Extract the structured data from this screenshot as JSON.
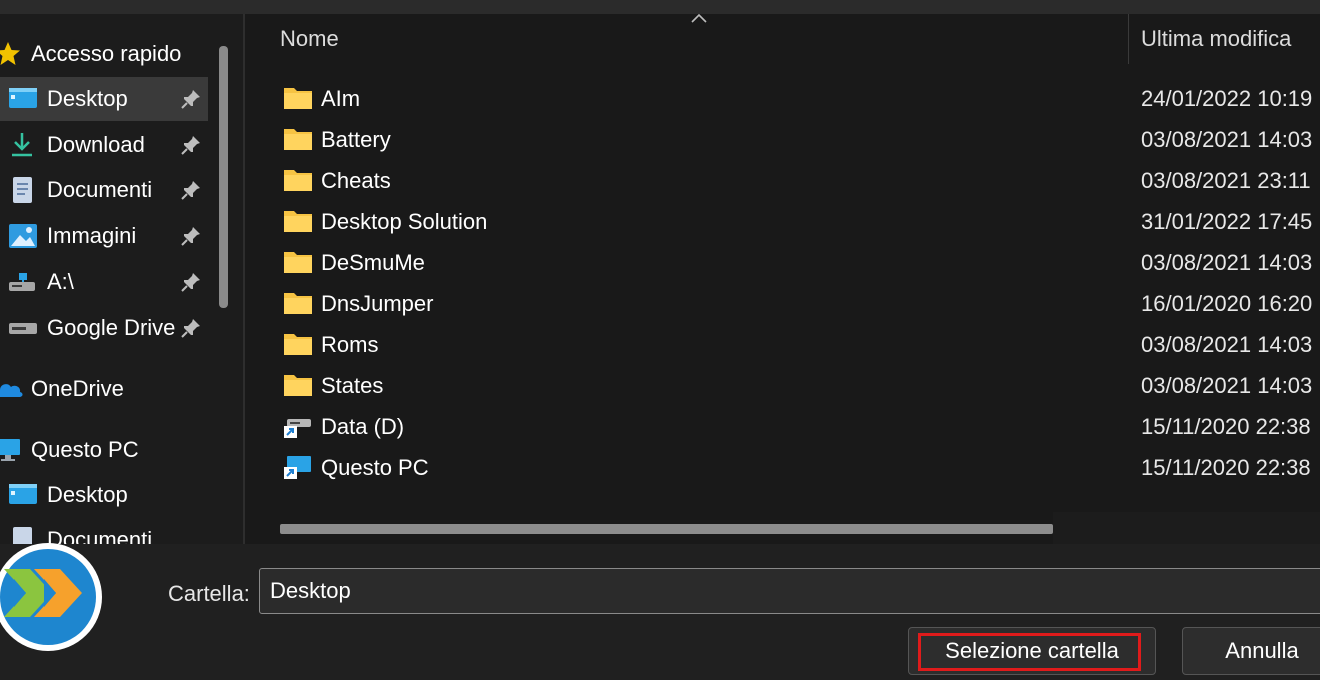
{
  "sidebar": {
    "items": [
      {
        "label": "Accesso rapido",
        "icon": "star-icon",
        "pinned": false,
        "selected": false
      },
      {
        "label": "Desktop",
        "icon": "desktop-icon",
        "pinned": true,
        "selected": true
      },
      {
        "label": "Download",
        "icon": "download-icon",
        "pinned": true,
        "selected": false
      },
      {
        "label": "Documenti",
        "icon": "document-icon",
        "pinned": true,
        "selected": false
      },
      {
        "label": "Immagini",
        "icon": "pictures-icon",
        "pinned": true,
        "selected": false
      },
      {
        "label": "A:\\",
        "icon": "network-drive-icon",
        "pinned": true,
        "selected": false
      },
      {
        "label": "Google Drive",
        "icon": "drive-icon",
        "pinned": true,
        "selected": false
      },
      {
        "label": "OneDrive",
        "icon": "cloud-icon",
        "pinned": false,
        "selected": false
      },
      {
        "label": "Questo PC",
        "icon": "computer-icon",
        "pinned": false,
        "selected": false
      },
      {
        "label": "Desktop",
        "icon": "desktop-icon",
        "pinned": false,
        "selected": false
      },
      {
        "label": "Documenti",
        "icon": "document-icon",
        "pinned": false,
        "selected": false
      }
    ]
  },
  "list": {
    "columns": {
      "name": "Nome",
      "modified": "Ultima modifica"
    },
    "rows": [
      {
        "name": "AIm",
        "modified": "24/01/2022 10:19",
        "icon": "folder-icon"
      },
      {
        "name": "Battery",
        "modified": "03/08/2021 14:03",
        "icon": "folder-icon"
      },
      {
        "name": "Cheats",
        "modified": "03/08/2021 23:11",
        "icon": "folder-icon"
      },
      {
        "name": "Desktop Solution",
        "modified": "31/01/2022 17:45",
        "icon": "folder-icon"
      },
      {
        "name": "DeSmuMe",
        "modified": "03/08/2021 14:03",
        "icon": "folder-icon"
      },
      {
        "name": "DnsJumper",
        "modified": "16/01/2020 16:20",
        "icon": "folder-icon"
      },
      {
        "name": "Roms",
        "modified": "03/08/2021 14:03",
        "icon": "folder-icon"
      },
      {
        "name": "States",
        "modified": "03/08/2021 14:03",
        "icon": "folder-icon"
      },
      {
        "name": "Data (D)",
        "modified": "15/11/2020 22:38",
        "icon": "drive-shortcut-icon"
      },
      {
        "name": "Questo PC",
        "modified": "15/11/2020 22:38",
        "icon": "pc-shortcut-icon"
      }
    ]
  },
  "footer": {
    "folder_label": "Cartella:",
    "folder_value": "Desktop",
    "select_button": "Selezione cartella",
    "cancel_button": "Annulla"
  },
  "colors": {
    "folder": "#f6c343",
    "highlight": "#e01b1b",
    "accent_blue": "#2a8fd8"
  }
}
